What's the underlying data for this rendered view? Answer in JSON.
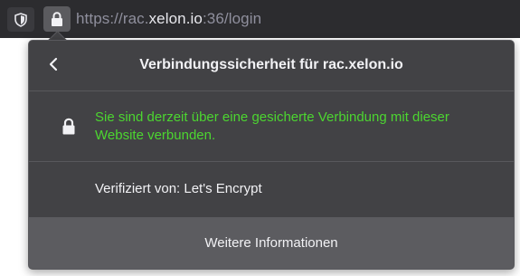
{
  "urlbar": {
    "url_scheme": "https://",
    "url_subdomain": "rac.",
    "url_domain": "xelon.io",
    "url_port_path": ":36/login",
    "shield_icon": "tracking-protection-shield-icon",
    "lock_icon": "padlock-icon"
  },
  "panel": {
    "back_icon": "chevron-left-icon",
    "title": "Verbindungssicherheit für rac.xelon.io",
    "secure_icon": "padlock-icon",
    "secure_message": "Sie sind derzeit über eine gesicherte Verbindung mit dieser Website verbunden.",
    "verified_by": "Verifiziert von: Let's Encrypt",
    "more_info_label": "Weitere Informationen"
  },
  "colors": {
    "toolbar_bg": "#2c2c2f",
    "panel_bg": "#424245",
    "button_bg": "#5c5c60",
    "secure_green": "#4cd630",
    "text_primary": "#f2f2f5",
    "text_muted": "#8f8f9d"
  }
}
